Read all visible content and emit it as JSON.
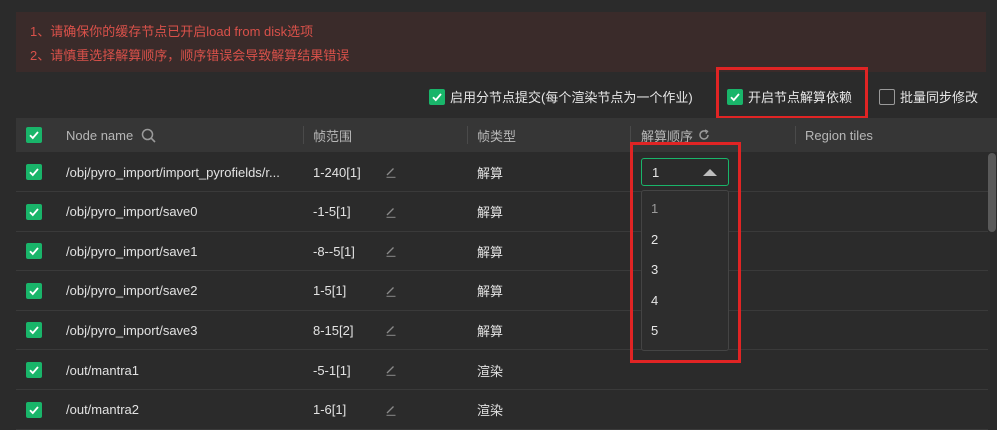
{
  "warnings": [
    "1、请确保你的缓存节点已开启load from disk选项",
    "2、请慎重选择解算顺序，顺序错误会导致解算结果错误"
  ],
  "options": {
    "split_submit": "启用分节点提交(每个渲染节点为一个作业)",
    "enable_dependency": "开启节点解算依赖",
    "batch_sync": "批量同步修改"
  },
  "table": {
    "headers": {
      "node_name": "Node name",
      "frame_range": "帧范围",
      "frame_type": "帧类型",
      "solve_order": "解算顺序",
      "region_tiles": "Region tiles"
    },
    "rows": [
      {
        "name": "/obj/pyro_import/import_pyrofields/r...",
        "range": "1-240[1]",
        "type": "解算"
      },
      {
        "name": "/obj/pyro_import/save0",
        "range": "-1-5[1]",
        "type": "解算"
      },
      {
        "name": "/obj/pyro_import/save1",
        "range": "-8--5[1]",
        "type": "解算"
      },
      {
        "name": "/obj/pyro_import/save2",
        "range": "1-5[1]",
        "type": "解算"
      },
      {
        "name": "/obj/pyro_import/save3",
        "range": "8-15[2]",
        "type": "解算"
      },
      {
        "name": "/out/mantra1",
        "range": "-5-1[1]",
        "type": "渲染"
      },
      {
        "name": "/out/mantra2",
        "range": "1-6[1]",
        "type": "渲染"
      }
    ]
  },
  "order_select": {
    "value": "1",
    "options": [
      "1",
      "2",
      "3",
      "4",
      "5"
    ]
  },
  "colors": {
    "accent": "#19b56a",
    "highlight": "#e02424",
    "warning_text": "#d9514a"
  }
}
